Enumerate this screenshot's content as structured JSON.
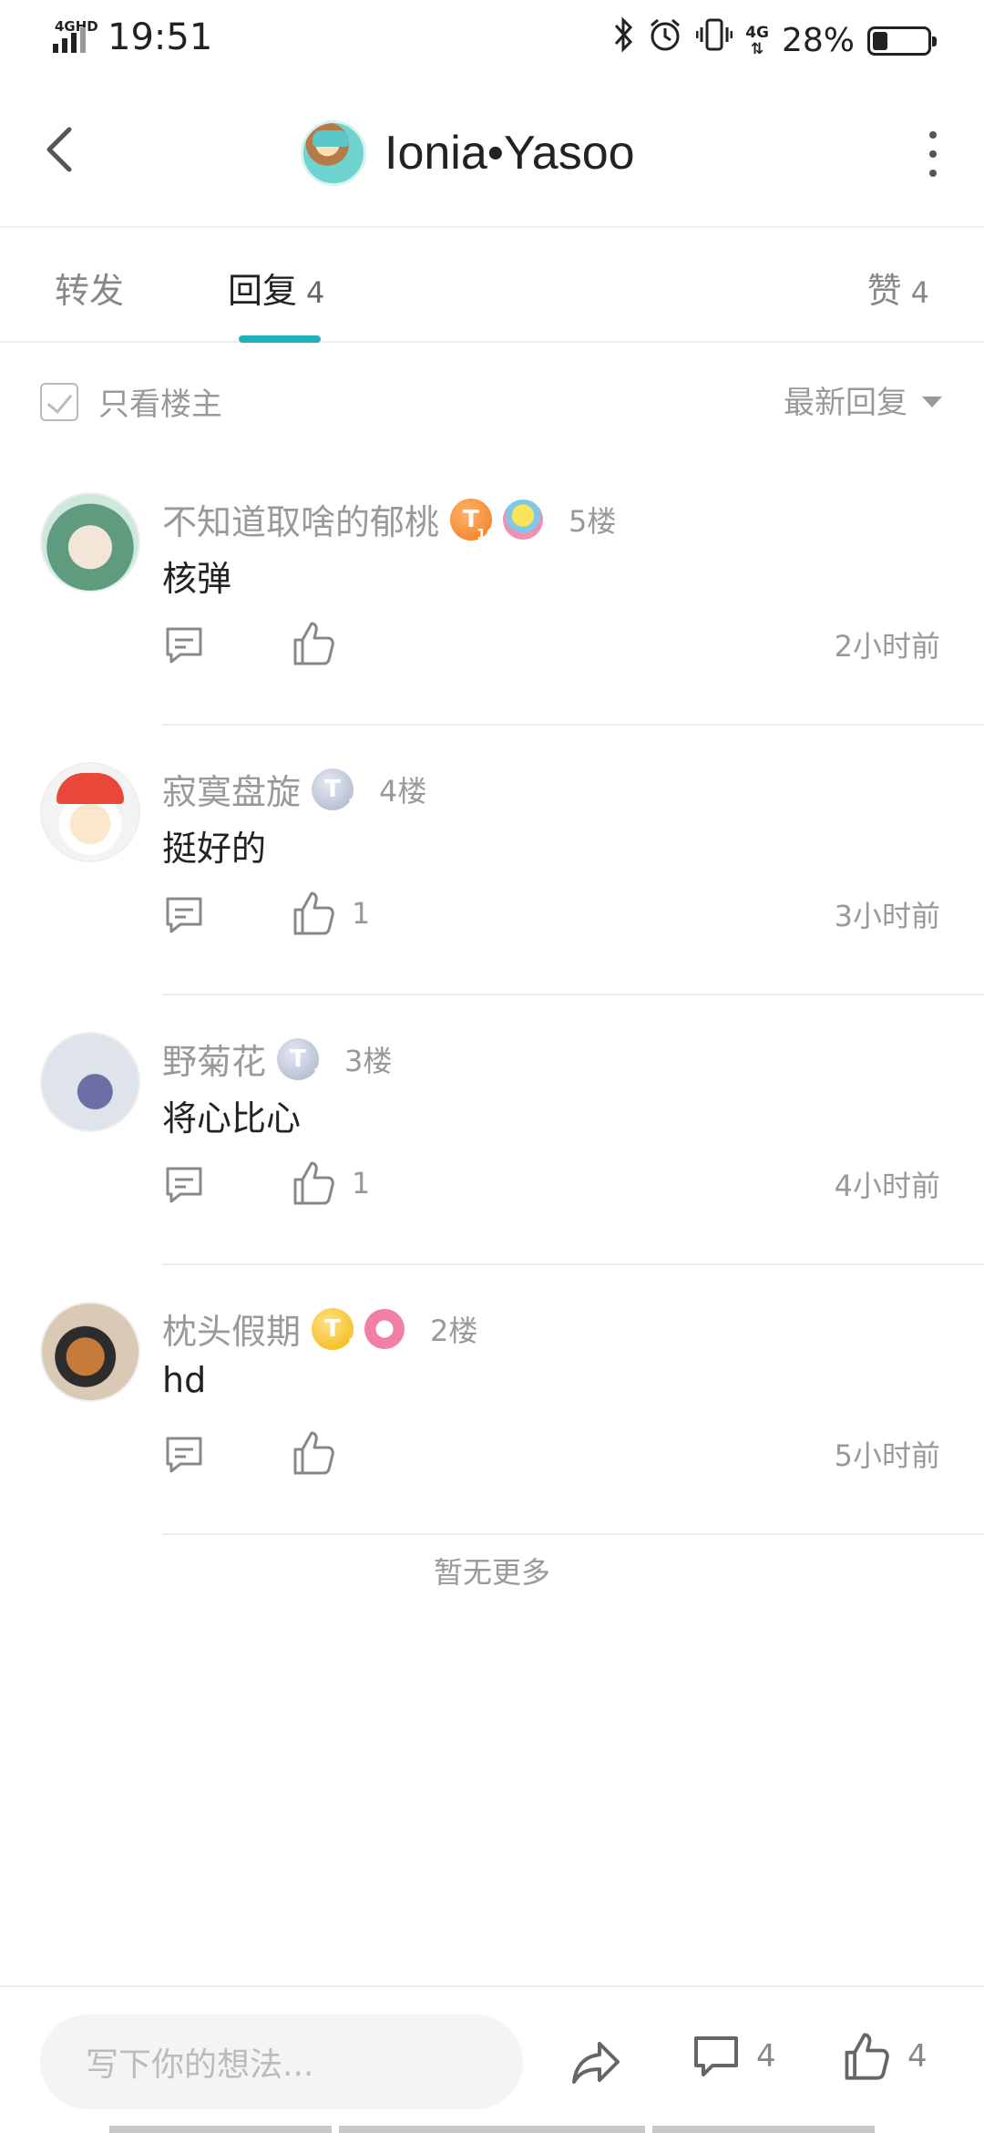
{
  "status_bar": {
    "network": "4GHD",
    "time": "19:51",
    "network_right": "4G",
    "battery_percent": "28%",
    "battery_level": 0.28,
    "icons": [
      "bluetooth-icon",
      "alarm-icon",
      "vibrate-icon",
      "signal-icon",
      "battery-icon"
    ]
  },
  "header": {
    "title": "Ionia•Yasoo",
    "back_icon": "chevron-left-icon",
    "more_icon": "more-vertical-icon"
  },
  "tabs": {
    "forward_label": "转发",
    "reply_label": "回复",
    "reply_count": "4",
    "like_label": "赞",
    "like_count": "4",
    "active": "reply",
    "accent_color": "#1fb1b8"
  },
  "filter": {
    "op_only_label": "只看楼主",
    "sort_label": "最新回复"
  },
  "comments": [
    {
      "name": "不知道取啥的郁桃",
      "badge": "T",
      "badge_level": "10",
      "floor": "5楼",
      "text": "核弹",
      "like_count": "",
      "time": "2小时前"
    },
    {
      "name": "寂寞盘旋",
      "badge": "T",
      "badge_level": "1",
      "floor": "4楼",
      "text": "挺好的",
      "like_count": "1",
      "time": "3小时前"
    },
    {
      "name": "野菊花",
      "badge": "T",
      "badge_level": "1",
      "floor": "3楼",
      "text": "将心比心",
      "like_count": "1",
      "time": "4小时前"
    },
    {
      "name": "枕头假期",
      "badge": "T",
      "badge_level": "1",
      "floor": "2楼",
      "text": "hd",
      "like_count": "",
      "time": "5小时前"
    }
  ],
  "no_more": "暂无更多",
  "bottom_bar": {
    "input_placeholder": "写下你的想法...",
    "comment_count": "4",
    "like_count": "4"
  }
}
